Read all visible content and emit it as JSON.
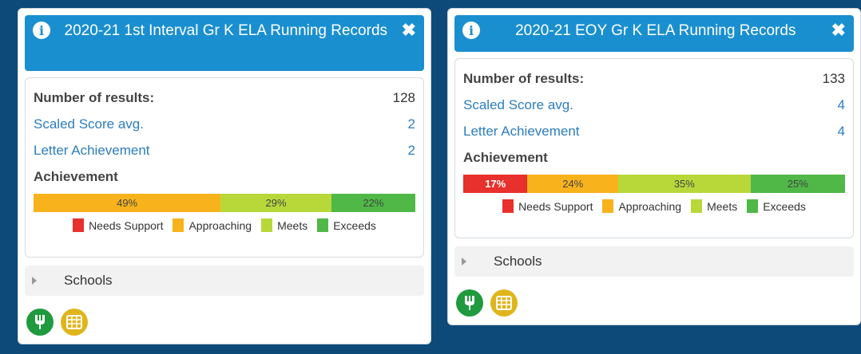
{
  "colors": {
    "header_bg": "#1a8fd0",
    "needs_support": "#e8302c",
    "approaching": "#f8b21c",
    "meets": "#b8d83a",
    "exceeds": "#4fb847",
    "link": "#2c7dbe",
    "green_button": "#1f9a3e",
    "yellow_button": "#e0b51c"
  },
  "legend": {
    "needs_support": "Needs Support",
    "approaching": "Approaching",
    "meets": "Meets",
    "exceeds": "Exceeds"
  },
  "cards": [
    {
      "title": "2020-21 1st Interval Gr K ELA Running Records",
      "stats": {
        "results_label": "Number of results:",
        "results_value": "128",
        "scaled_label": "Scaled Score avg.",
        "scaled_value": "2",
        "letter_label": "Letter Achievement",
        "letter_value": "2"
      },
      "achievement_label": "Achievement",
      "achievement": {
        "needs_support": {
          "pct": 0,
          "label": ""
        },
        "approaching": {
          "pct": 49,
          "label": "49%"
        },
        "meets": {
          "pct": 29,
          "label": "29%"
        },
        "exceeds": {
          "pct": 22,
          "label": "22%"
        }
      },
      "schools_label": "Schools"
    },
    {
      "title": "2020-21 EOY Gr K ELA Running Records",
      "stats": {
        "results_label": "Number of results:",
        "results_value": "133",
        "scaled_label": "Scaled Score avg.",
        "scaled_value": "4",
        "letter_label": "Letter Achievement",
        "letter_value": "4"
      },
      "achievement_label": "Achievement",
      "achievement": {
        "needs_support": {
          "pct": 17,
          "label": "17%"
        },
        "approaching": {
          "pct": 24,
          "label": "24%"
        },
        "meets": {
          "pct": 35,
          "label": "35%"
        },
        "exceeds": {
          "pct": 25,
          "label": "25%"
        }
      },
      "schools_label": "Schools"
    }
  ]
}
